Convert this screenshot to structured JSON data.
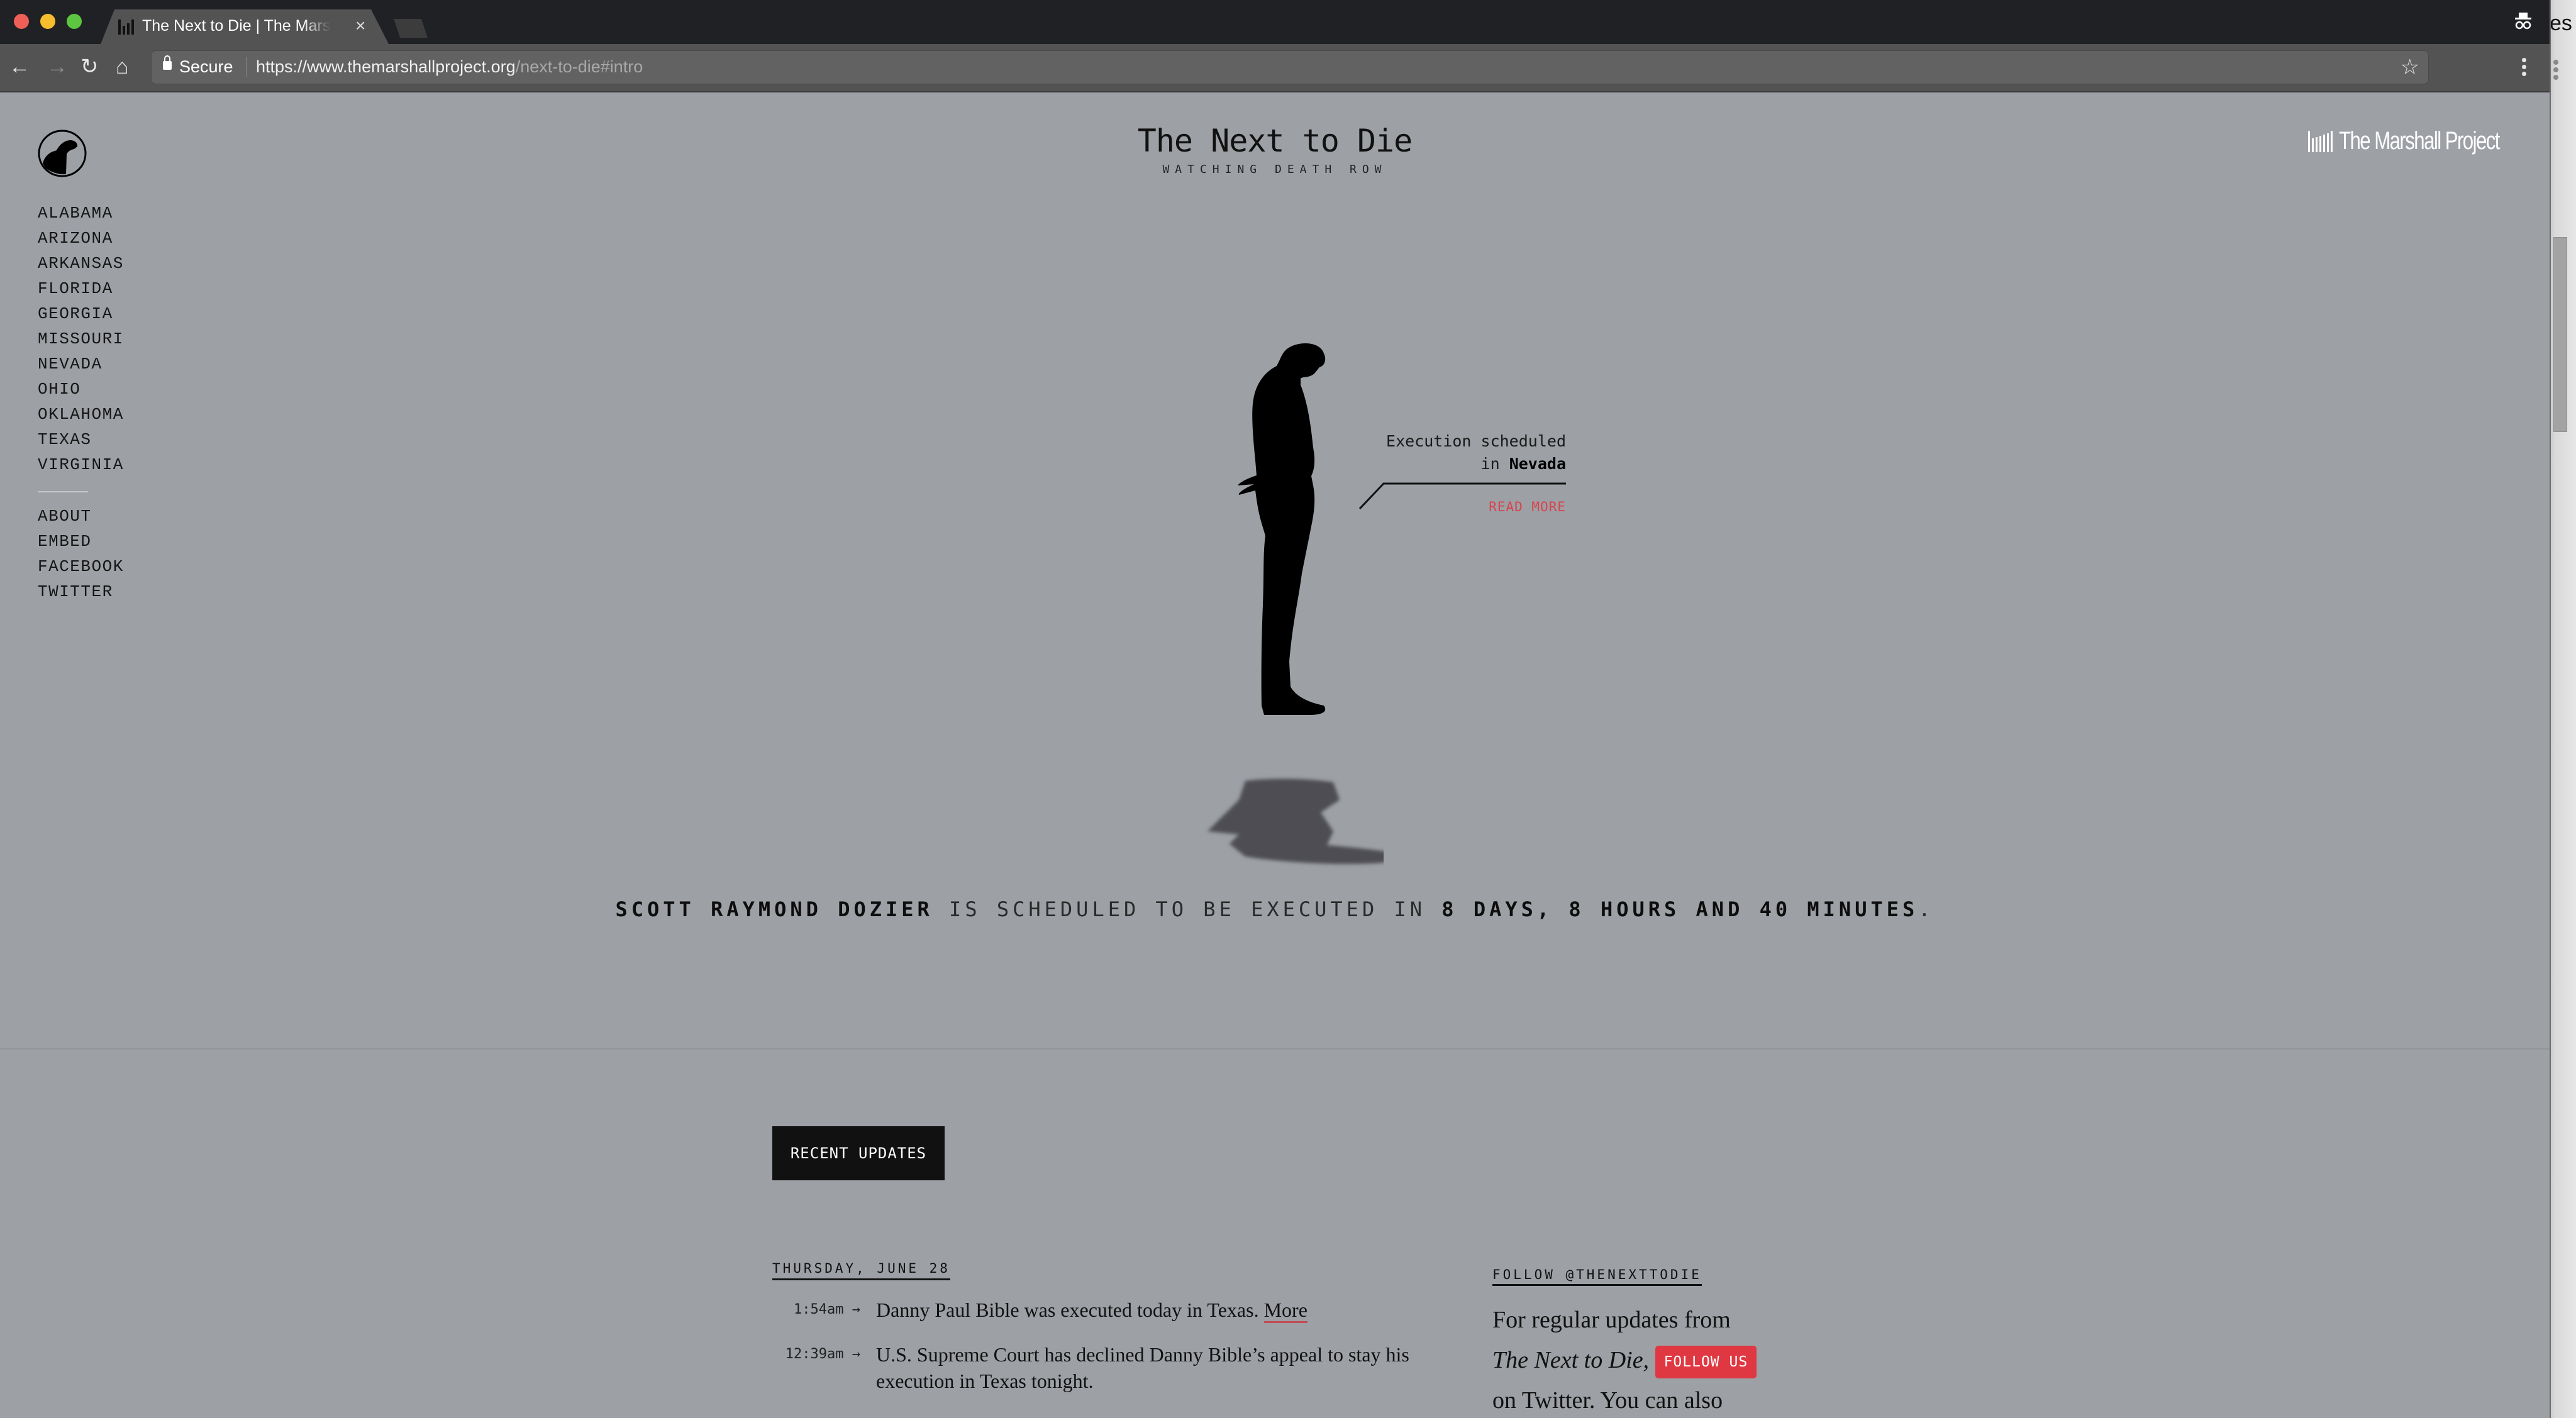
{
  "browser": {
    "tab_title": "The Next to Die | The Marshall Project",
    "tab_close": "×",
    "secure_label": "Secure",
    "url_host": "https://www.themarshallproject.org",
    "url_path": "/next-to-die#intro",
    "back_icon": "←",
    "forward_icon": "→",
    "reload_icon": "↻",
    "home_icon": "⌂",
    "star_icon": "☆"
  },
  "background_window": {
    "partial_text": "es"
  },
  "header": {
    "title": "The Next to Die",
    "subtitle": "WATCHING DEATH ROW",
    "brand": "The Marshall Project"
  },
  "sidebar": {
    "states": [
      "ALABAMA",
      "ARIZONA",
      "ARKANSAS",
      "FLORIDA",
      "GEORGIA",
      "MISSOURI",
      "NEVADA",
      "OHIO",
      "OKLAHOMA",
      "TEXAS",
      "VIRGINIA"
    ],
    "links": [
      "ABOUT",
      "EMBED",
      "FACEBOOK",
      "TWITTER"
    ]
  },
  "hero": {
    "callout_line1": "Execution scheduled",
    "callout_line2_prefix": "in ",
    "callout_state": "Nevada",
    "read_more": "READ MORE",
    "countdown": {
      "name": "SCOTT RAYMOND DOZIER",
      "middle": " IS SCHEDULED TO BE EXECUTED IN ",
      "remaining": "8 DAYS, 8 HOURS AND 40 MINUTES",
      "end": "."
    }
  },
  "updates": {
    "label": "RECENT UPDATES",
    "date": "THURSDAY, JUNE 28",
    "items": [
      {
        "time": "1:54am →",
        "text": "Danny Paul Bible was executed today in Texas. ",
        "link": "More"
      },
      {
        "time": "12:39am →",
        "text": "U.S. Supreme Court has declined Danny Bible’s appeal to stay his execution in Texas tonight.",
        "link": ""
      }
    ]
  },
  "follow": {
    "heading": "FOLLOW @THENEXTTODIE",
    "text_before": "For regular updates from ",
    "italic": "The Next to Die,",
    "button": "FOLLOW US",
    "text_after": "on Twitter. You can also"
  },
  "colors": {
    "page_bg": "#9da0a5",
    "accent_red": "#e03842",
    "link_red": "#d8434d",
    "chrome_dark": "#202124",
    "chrome_toolbar": "#535353"
  }
}
